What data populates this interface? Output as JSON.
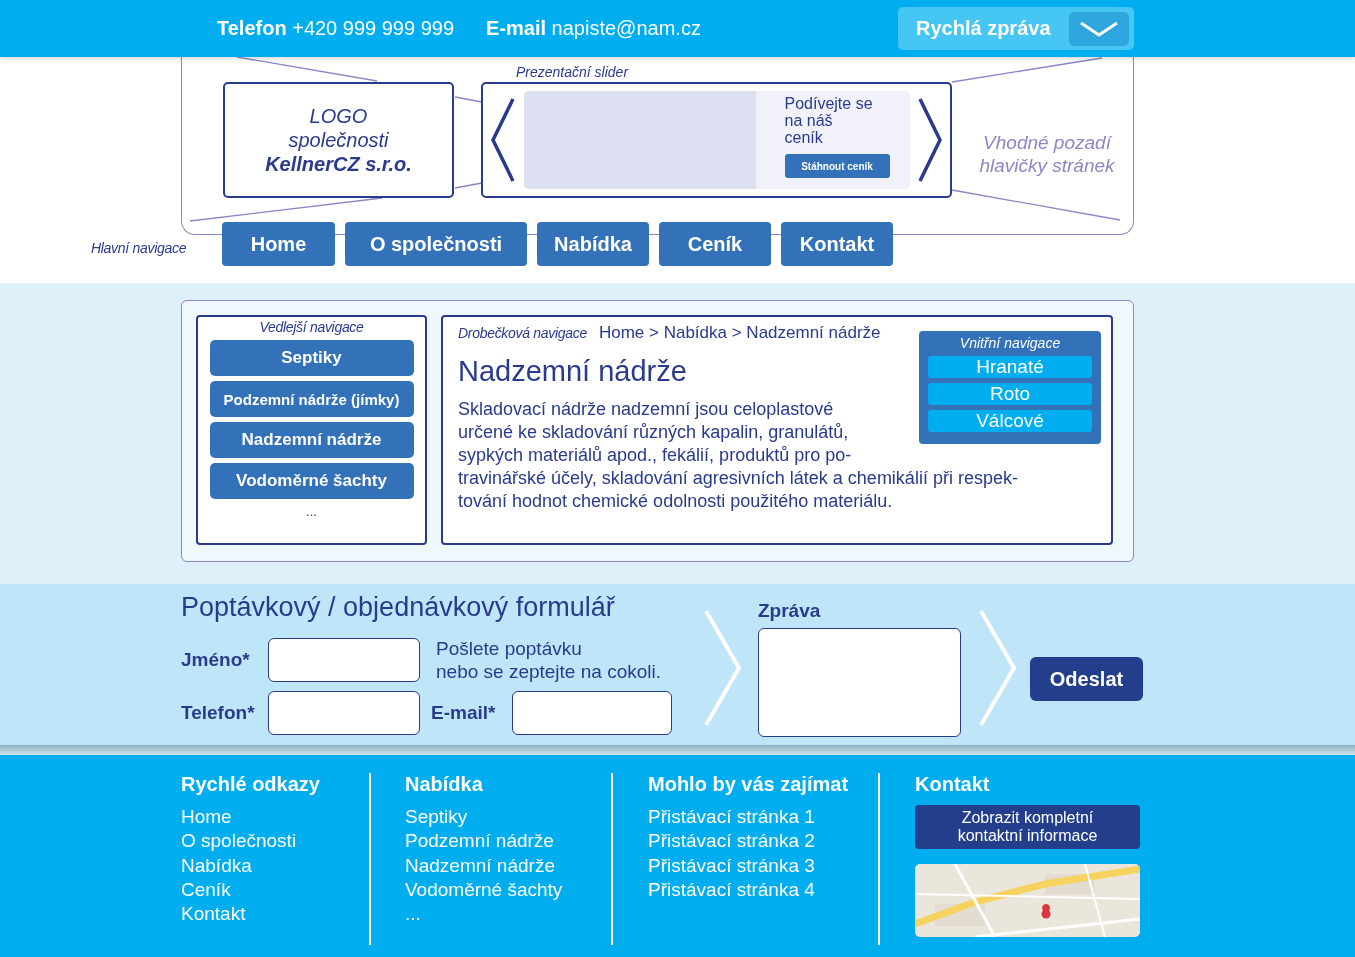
{
  "top_bar": {
    "phone_label": "Telefon",
    "phone": "+420 999 999 999",
    "email_label": "E-mail",
    "email": "napiste@nam.cz",
    "quick_message": "Rychlá zpráva"
  },
  "header": {
    "logo_lines": [
      {
        "text": "LOGO",
        "bold": false
      },
      {
        "text": "společnosti",
        "bold": false
      },
      {
        "text": "KellnerCZ s.r.o.",
        "bold": true
      }
    ],
    "slider_label": "Prezentační slider",
    "slider_lines": [
      "Podívejte se",
      "na náš",
      "ceník"
    ],
    "slider_button": "Stáhnout ceník",
    "background_note": "Vhodné pozadí hlavičky stránek",
    "main_nav_label": "Hlavní navigace",
    "main_nav": [
      "Home",
      "O společnosti",
      "Nabídka",
      "Ceník",
      "Kontakt"
    ]
  },
  "content": {
    "side_nav_label": "Vedlejší navigace",
    "side_nav": [
      "Septiky",
      "Podzemní nádrže (jímky)",
      "Nadzemní nádrže",
      "Vodoměrné šachty"
    ],
    "side_nav_more": "...",
    "breadcrumb_label": "Drobečková navigace",
    "breadcrumb": "Home > Nabídka > Nadzemní nádrže",
    "heading": "Nadzemní nádrže",
    "paragraph_beside_nav": [
      "Skladovací nádrže nadzemní jsou celoplastové",
      "určené ke skladování různých kapalin, granulátů,",
      "sypkých materiálů apod., fekálií, produktů pro po-"
    ],
    "paragraph_below_nav": [
      "travinářské účely, skladování agresivních látek a chemikálií při respek-",
      "tování hodnot chemické odolnosti použitého materiálu."
    ],
    "inner_nav_label": "Vnitřní navigace",
    "inner_nav": [
      "Hranaté",
      "Roto",
      "Válcové"
    ]
  },
  "form": {
    "title": "Poptávkový / objednávkový formulář",
    "name_label": "Jméno*",
    "phone_label": "Telefon*",
    "email_label": "E-mail*",
    "note_lines": [
      "Pošlete poptávku",
      "nebo se zeptejte na cokoli."
    ],
    "message_label": "Zpráva",
    "submit": "Odeslat"
  },
  "footer": {
    "columns": [
      {
        "heading": "Rychlé odkazy",
        "links": [
          "Home",
          "O společnosti",
          "Nabídka",
          "Ceník",
          "Kontakt"
        ]
      },
      {
        "heading": "Nabídka",
        "links": [
          "Septiky",
          "Podzemní nádrže",
          "Nadzemní nádrže",
          "Vodoměrné šachty",
          "..."
        ]
      },
      {
        "heading": "Mohlo by vás zajímat",
        "links": [
          "Přistávací stránka 1",
          "Přistávací stránka 2",
          "Přistávací stránka 3",
          "Přistávací stránka 4"
        ]
      }
    ],
    "contact": {
      "heading": "Kontakt",
      "button": "Zobrazit kompletní kontaktní informace"
    }
  }
}
